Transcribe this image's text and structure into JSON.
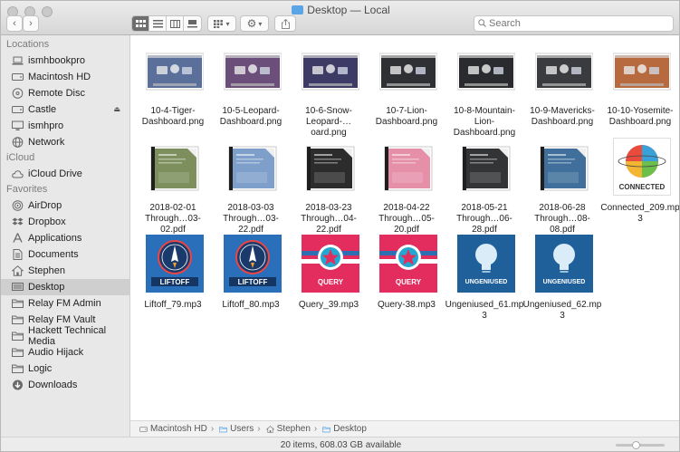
{
  "window": {
    "title": "Desktop — Local"
  },
  "toolbar": {
    "back_icon": "chevron-left",
    "forward_icon": "chevron-right",
    "view_modes": [
      "icon",
      "list",
      "column",
      "gallery"
    ],
    "arrange_icon": "grid-arrange",
    "action_icon": "gear",
    "share_icon": "share",
    "search_placeholder": "Search"
  },
  "sidebar": {
    "sections": [
      {
        "title": "Locations",
        "items": [
          {
            "label": "ismhbookpro",
            "icon": "laptop"
          },
          {
            "label": "Macintosh HD",
            "icon": "hard-drive"
          },
          {
            "label": "Remote Disc",
            "icon": "disc"
          },
          {
            "label": "Castle",
            "icon": "hard-drive",
            "eject": true
          },
          {
            "label": "ismhpro",
            "icon": "display"
          },
          {
            "label": "Network",
            "icon": "globe"
          }
        ]
      },
      {
        "title": "iCloud",
        "items": [
          {
            "label": "iCloud Drive",
            "icon": "cloud"
          }
        ]
      },
      {
        "title": "Favorites",
        "items": [
          {
            "label": "AirDrop",
            "icon": "airdrop"
          },
          {
            "label": "Dropbox",
            "icon": "dropbox"
          },
          {
            "label": "Applications",
            "icon": "applications"
          },
          {
            "label": "Documents",
            "icon": "document"
          },
          {
            "label": "Stephen",
            "icon": "home"
          },
          {
            "label": "Desktop",
            "icon": "desktop",
            "selected": true
          },
          {
            "label": "Relay FM Admin",
            "icon": "folder"
          },
          {
            "label": "Relay FM Vault",
            "icon": "folder"
          },
          {
            "label": "Hackett Technical Media",
            "icon": "folder"
          },
          {
            "label": "Audio Hijack",
            "icon": "folder"
          },
          {
            "label": "Logic",
            "icon": "folder"
          },
          {
            "label": "Downloads",
            "icon": "download"
          }
        ]
      }
    ]
  },
  "files": [
    {
      "name": "10-4-Tiger-Dashboard.png",
      "caption": [
        "10-4-Tiger-",
        "Dashboard.png"
      ],
      "kind": "screenshot",
      "color": "#5a6f9a"
    },
    {
      "name": "10-5-Leopard-Dashboard.png",
      "caption": [
        "10-5-Leopard-",
        "Dashboard.png"
      ],
      "kind": "screenshot",
      "color": "#6b4f7a"
    },
    {
      "name": "10-6-Snow-Leopard-...oard.png",
      "caption": [
        "10-6-Snow-",
        "Leopard-…oard.png"
      ],
      "kind": "screenshot",
      "color": "#3d3a66"
    },
    {
      "name": "10-7-Lion-Dashboard.png",
      "caption": [
        "10-7-Lion-",
        "Dashboard.png"
      ],
      "kind": "screenshot",
      "color": "#2f3034"
    },
    {
      "name": "10-8-Mountain-Lion-Dashboard.png",
      "caption": [
        "10-8-Mountain-",
        "Lion-Dashboard.png"
      ],
      "kind": "screenshot",
      "color": "#2a2b2e"
    },
    {
      "name": "10-9-Mavericks-Dashboard.png",
      "caption": [
        "10-9-Mavericks-",
        "Dashboard.png"
      ],
      "kind": "screenshot",
      "color": "#3a3b3f"
    },
    {
      "name": "10-10-Yosemite-Dashboard.png",
      "caption": [
        "10-10-Yosemite-",
        "Dashboard.png"
      ],
      "kind": "screenshot",
      "color": "#b66a3d"
    },
    {
      "name": "2018-02-01 Through...03-02.pdf",
      "caption": [
        "2018-02-01",
        "Through…03-02.pdf"
      ],
      "kind": "pdf",
      "color": "#7c8f5c"
    },
    {
      "name": "2018-03-03 Through...03-22.pdf",
      "caption": [
        "2018-03-03",
        "Through…03-22.pdf"
      ],
      "kind": "pdf",
      "color": "#7e9fc9"
    },
    {
      "name": "2018-03-23 Through...04-22.pdf",
      "caption": [
        "2018-03-23",
        "Through…04-22.pdf"
      ],
      "kind": "pdf",
      "color": "#2c2c2c"
    },
    {
      "name": "2018-04-22 Through...05-20.pdf",
      "caption": [
        "2018-04-22",
        "Through…05-20.pdf"
      ],
      "kind": "pdf",
      "color": "#e58fa8"
    },
    {
      "name": "2018-05-21 Through...06-28.pdf",
      "caption": [
        "2018-05-21",
        "Through…06-28.pdf"
      ],
      "kind": "pdf",
      "color": "#333436"
    },
    {
      "name": "2018-06-28 Through...08-08.pdf",
      "caption": [
        "2018-06-28",
        "Through…08-08.pdf"
      ],
      "kind": "pdf",
      "color": "#3f6f9a"
    },
    {
      "name": "Connected_209.mp3",
      "caption": [
        "Connected_209.mp",
        "3"
      ],
      "kind": "connected",
      "art_text": "CONNECTED"
    },
    {
      "name": "Liftoff_79.mp3",
      "caption": [
        "Liftoff_79.mp3"
      ],
      "kind": "liftoff",
      "art_text": "LIFTOFF"
    },
    {
      "name": "Liftoff_80.mp3",
      "caption": [
        "Liftoff_80.mp3"
      ],
      "kind": "liftoff",
      "art_text": "LIFTOFF"
    },
    {
      "name": "Query_39.mp3",
      "caption": [
        "Query_39.mp3"
      ],
      "kind": "query",
      "art_text": "QUERY"
    },
    {
      "name": "Query-38.mp3",
      "caption": [
        "Query-38.mp3"
      ],
      "kind": "query",
      "art_text": "QUERY"
    },
    {
      "name": "Ungeniused_61.mp3",
      "caption": [
        "Ungeniused_61.mp",
        "3"
      ],
      "kind": "ungeniused",
      "art_text": "UNGENIUSED"
    },
    {
      "name": "Ungeniused_62.mp3",
      "caption": [
        "Ungeniused_62.mp",
        "3"
      ],
      "kind": "ungeniused",
      "art_text": "UNGENIUSED"
    }
  ],
  "pathbar": [
    {
      "label": "Macintosh HD",
      "icon": "hard-drive"
    },
    {
      "label": "Users",
      "icon": "folder"
    },
    {
      "label": "Stephen",
      "icon": "home"
    },
    {
      "label": "Desktop",
      "icon": "folder"
    }
  ],
  "status": {
    "text": "20 items, 608.03 GB available"
  },
  "colors": {
    "selected_bg": "#cfcfcf",
    "folder_blue": "#5aa5e6",
    "sidebar_bg": "#e9e8e8"
  }
}
